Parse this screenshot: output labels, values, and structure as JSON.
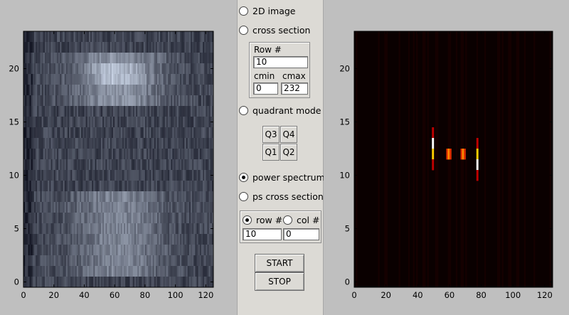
{
  "left_plot": {
    "x_ticks": [
      "0",
      "20",
      "40",
      "60",
      "80",
      "100",
      "120"
    ],
    "y_ticks": [
      "0",
      "5",
      "10",
      "15",
      "20"
    ]
  },
  "right_plot": {
    "x_ticks": [
      "0",
      "20",
      "40",
      "60",
      "80",
      "100",
      "120"
    ],
    "y_ticks": [
      "0",
      "5",
      "10",
      "15",
      "20"
    ]
  },
  "controls": {
    "image_2d": {
      "label": "2D image",
      "checked": false
    },
    "cross_section": {
      "label": "cross section",
      "checked": false
    },
    "row_label": "Row #",
    "row_value": "10",
    "cmin_label": "cmin",
    "cmax_label": "cmax",
    "cmin_value": "0",
    "cmax_value": "232",
    "quadrant_mode": {
      "label": "quadrant mode",
      "checked": false
    },
    "quadrants": {
      "q3": "Q3",
      "q4": "Q4",
      "q1": "Q1",
      "q2": "Q2"
    },
    "power_spectrum": {
      "label": "power spectrum",
      "checked": true
    },
    "ps_cross_section": {
      "label": "ps cross section",
      "checked": false
    },
    "row_radio": {
      "label": "row #",
      "checked": true
    },
    "col_radio": {
      "label": "col #",
      "checked": false
    },
    "row_num_value": "10",
    "col_num_value": "0",
    "start_label": "START",
    "stop_label": "STOP"
  },
  "colors": {
    "left_colormap": "bone",
    "right_colormap": "hot"
  }
}
